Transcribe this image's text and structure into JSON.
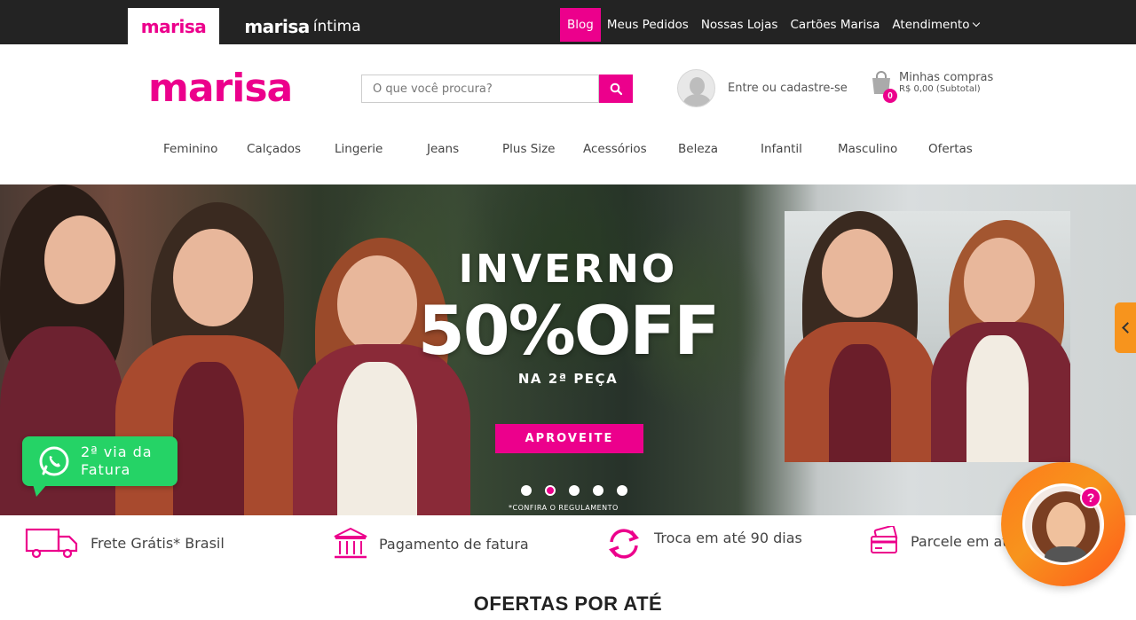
{
  "topbar": {
    "brand_tabs": [
      {
        "label": "marisa"
      },
      {
        "label": "marisa",
        "sub": "íntima"
      }
    ],
    "links": [
      "Blog",
      "Meus Pedidos",
      "Nossas Lojas",
      "Cartões Marisa",
      "Atendimento"
    ]
  },
  "header": {
    "logo": "marisa",
    "search_placeholder": "O que você procura?",
    "account_label": "Entre ou cadastre-se",
    "cart_title": "Minhas compras",
    "cart_subtotal": "R$ 0,00 (Subtotal)",
    "cart_count": "0"
  },
  "categories": [
    "Feminino",
    "Calçados",
    "Lingerie",
    "Jeans",
    "Plus Size",
    "Acessórios",
    "Beleza",
    "Infantil",
    "Masculino",
    "Ofertas"
  ],
  "hero": {
    "line1": "INVERNO",
    "line2": "50%OFF",
    "line3": "NA 2ª PEÇA",
    "cta": "APROVEITE",
    "disclaimer": "*CONFIRA O REGULAMENTO",
    "slide_count": 5,
    "active_slide": 2
  },
  "whatsapp": {
    "line1": "2ª via da",
    "line2": "Fatura"
  },
  "benefits": [
    {
      "icon": "truck-icon",
      "label": "Frete Grátis* Brasil"
    },
    {
      "icon": "bank-icon",
      "label": "Pagamento de fatura"
    },
    {
      "icon": "exchange-icon",
      "label": "Troca em até 90 dias"
    },
    {
      "icon": "card-icon",
      "label": "Parcele em at"
    }
  ],
  "section_title": "OFERTAS POR ATÉ",
  "chat": {
    "badge": "?"
  },
  "colors": {
    "brand": "#ec008c",
    "topbar": "#232323",
    "whatsapp": "#25d366",
    "accent_orange": "#f7941d"
  }
}
